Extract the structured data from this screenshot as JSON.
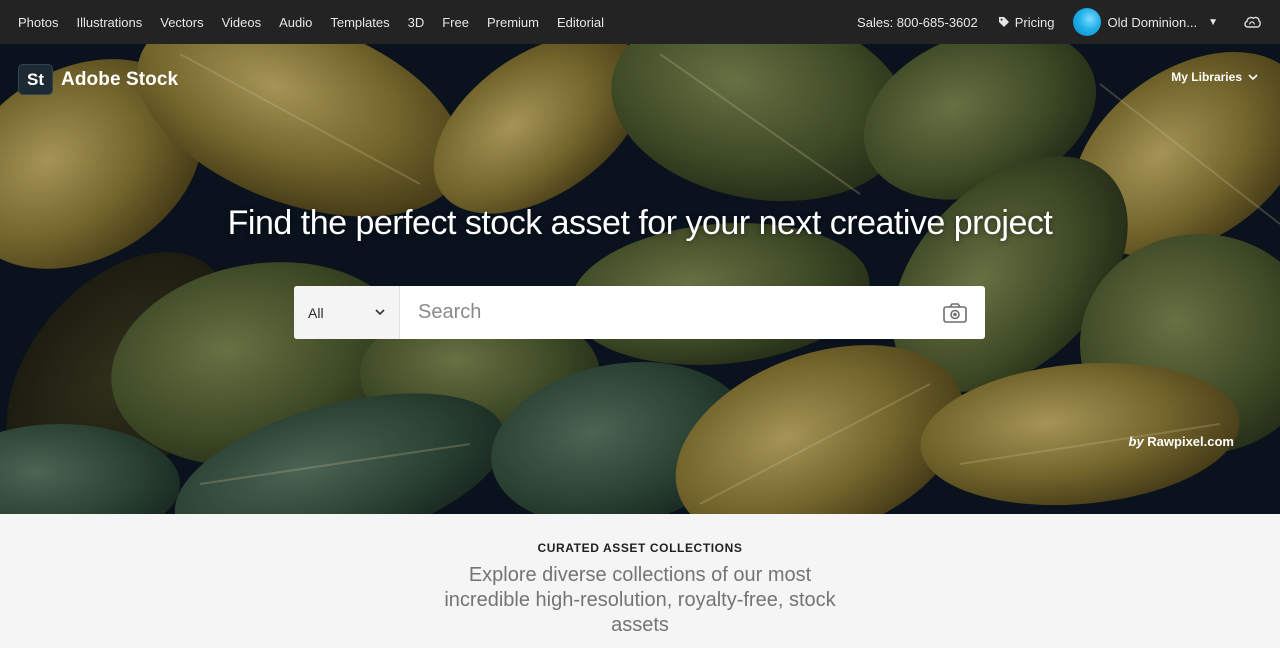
{
  "nav": {
    "links": [
      "Photos",
      "Illustrations",
      "Vectors",
      "Videos",
      "Audio",
      "Templates",
      "3D",
      "Free",
      "Premium",
      "Editorial"
    ],
    "sales": "Sales: 800-685-3602",
    "pricing": "Pricing",
    "account": "Old Dominion..."
  },
  "brand": {
    "logo": "St",
    "name": "Adobe Stock"
  },
  "libraries": "My Libraries",
  "hero": {
    "headline": "Find the perfect stock asset for your next creative project",
    "credit_by": "by",
    "credit_name": "Rawpixel.com"
  },
  "search": {
    "scope": "All",
    "placeholder": "Search"
  },
  "curated": {
    "eyebrow": "CURATED ASSET COLLECTIONS",
    "description": "Explore diverse collections of our most incredible high-resolution, royalty-free, stock assets"
  },
  "icons": {
    "pricing": "tag-icon",
    "account_caret": "chevron-down-icon",
    "creative_cloud": "creative-cloud-icon",
    "camera": "camera-icon"
  }
}
